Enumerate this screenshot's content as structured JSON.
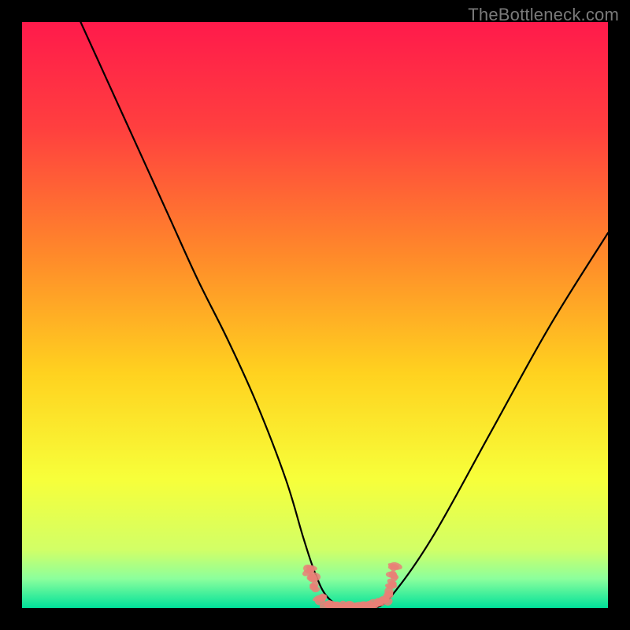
{
  "watermark": "TheBottleneck.com",
  "chart_data": {
    "type": "line",
    "title": "",
    "xlabel": "",
    "ylabel": "",
    "xlim": [
      0,
      100
    ],
    "ylim": [
      0,
      100
    ],
    "gradient_stops": [
      {
        "offset": 0,
        "color": "#ff1a4b"
      },
      {
        "offset": 18,
        "color": "#ff3f3f"
      },
      {
        "offset": 40,
        "color": "#ff8a2a"
      },
      {
        "offset": 60,
        "color": "#ffd21f"
      },
      {
        "offset": 78,
        "color": "#f7ff3a"
      },
      {
        "offset": 90,
        "color": "#d2ff66"
      },
      {
        "offset": 95,
        "color": "#8cff9c"
      },
      {
        "offset": 100,
        "color": "#00e19a"
      }
    ],
    "series": [
      {
        "name": "bottleneck-curve",
        "x": [
          10,
          15,
          20,
          25,
          30,
          35,
          40,
          45,
          48,
          50,
          52,
          55,
          58,
          60,
          63,
          70,
          80,
          90,
          100
        ],
        "values": [
          100,
          89,
          78,
          67,
          56,
          46,
          35,
          22,
          12,
          6,
          2,
          0,
          0,
          0,
          2,
          12,
          30,
          48,
          64
        ]
      }
    ],
    "flat_region": {
      "x_start": 50,
      "x_end": 63
    },
    "markers": {
      "name": "flat-region-markers",
      "color": "#e98077",
      "points": [
        {
          "x": 49.0,
          "y": 6.5
        },
        {
          "x": 49.5,
          "y": 5.0
        },
        {
          "x": 50.0,
          "y": 3.5
        },
        {
          "x": 51.0,
          "y": 1.5
        },
        {
          "x": 52.0,
          "y": 0.5
        },
        {
          "x": 53.0,
          "y": 0.3
        },
        {
          "x": 54.0,
          "y": 0.2
        },
        {
          "x": 55.0,
          "y": 0.2
        },
        {
          "x": 56.0,
          "y": 0.2
        },
        {
          "x": 57.0,
          "y": 0.2
        },
        {
          "x": 58.0,
          "y": 0.3
        },
        {
          "x": 59.0,
          "y": 0.4
        },
        {
          "x": 60.0,
          "y": 0.5
        },
        {
          "x": 61.0,
          "y": 0.8
        },
        {
          "x": 62.0,
          "y": 1.2
        },
        {
          "x": 62.5,
          "y": 2.5
        },
        {
          "x": 63.0,
          "y": 4.0
        },
        {
          "x": 63.3,
          "y": 5.5
        },
        {
          "x": 63.7,
          "y": 7.0
        }
      ]
    }
  }
}
